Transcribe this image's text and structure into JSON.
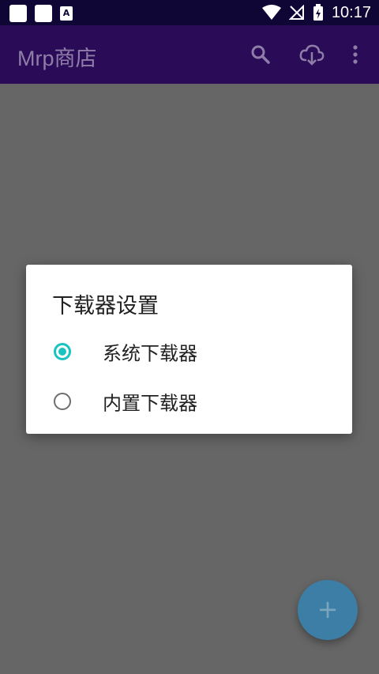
{
  "status_bar": {
    "time": "10:17",
    "notification_icons": [
      "square-notification-icon",
      "square-notification-icon",
      "font-notification-icon"
    ],
    "font_icon_letter": "A",
    "system_icons": [
      "wifi-icon",
      "no-signal-icon",
      "battery-charging-icon"
    ]
  },
  "app_bar": {
    "title": "Mrp商店",
    "actions": [
      "search-icon",
      "cloud-download-icon",
      "more-vert-icon"
    ]
  },
  "dialog": {
    "title": "下载器设置",
    "options": [
      {
        "label": "系统下载器",
        "checked": true
      },
      {
        "label": "内置下载器",
        "checked": false
      }
    ]
  },
  "fab": {
    "icon": "plus-icon",
    "glyph": "+"
  },
  "colors": {
    "status_bar": "#0f0636",
    "app_bar": "#2a0b57",
    "scrim": "#666666",
    "accent": "#19c3c0",
    "fab": "#3c7ea6"
  }
}
